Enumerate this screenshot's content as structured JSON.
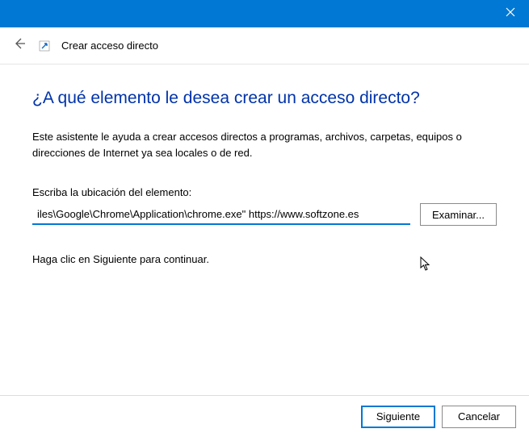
{
  "titlebar": {
    "close": "Close"
  },
  "header": {
    "title": "Crear acceso directo"
  },
  "main": {
    "question": "¿A qué elemento le desea crear un acceso directo?",
    "description": "Este asistente le ayuda a crear accesos directos a programas, archivos, carpetas, equipos o direcciones de Internet ya sea locales o de red.",
    "field_label": "Escriba la ubicación del elemento:",
    "location_value": "iles\\Google\\Chrome\\Application\\chrome.exe\" https://www.softzone.es",
    "browse_label": "Examinar...",
    "continue_text": "Haga clic en Siguiente para continuar."
  },
  "footer": {
    "next_label": "Siguiente",
    "cancel_label": "Cancelar"
  }
}
